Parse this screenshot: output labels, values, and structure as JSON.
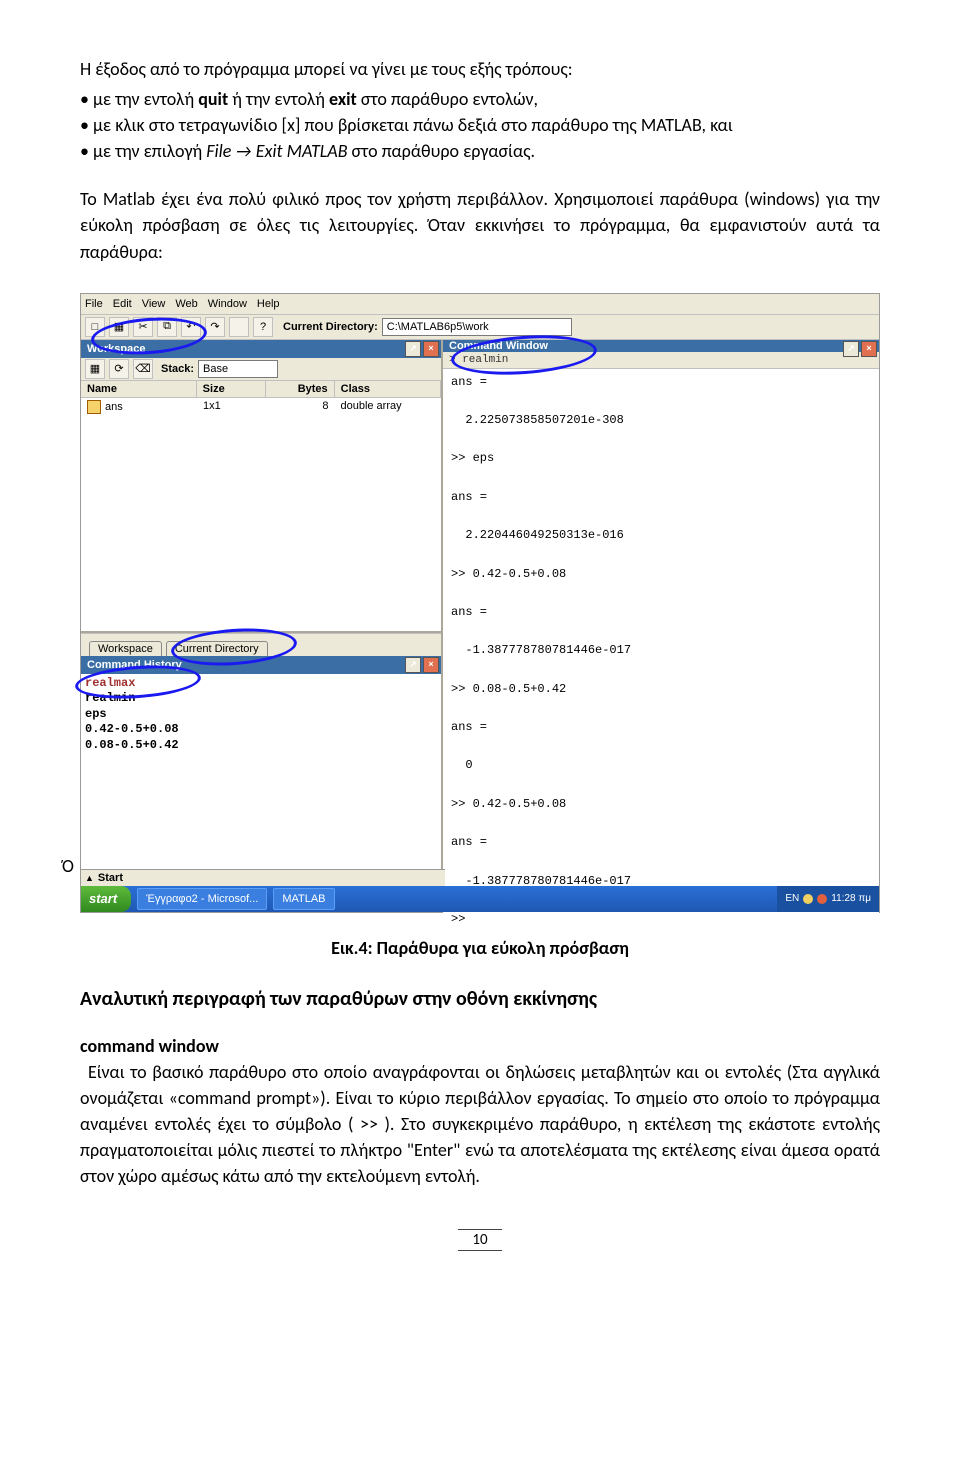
{
  "p1": "Η έξοδος από το πρόγραμμα μπορεί να γίνει με τους εξής τρόπους:",
  "b1_pre": "• με την εντολή ",
  "b1_q": "quit",
  "b1_mid": " ή την εντολή ",
  "b1_e": "exit",
  "b1_post": " στο παράθυρο εντολών,",
  "b2": "• με κλικ στο τετραγωνίδιο [x] που βρίσκεται πάνω δεξιά στο παράθυρο της MATLAB, και",
  "b3_pre": "• με την επιλογή ",
  "b3_i": "File → Exit MATLAB",
  "b3_post": " στο παράθυρο εργασίας.",
  "p2": "Το Matlab έχει ένα πολύ φιλικό προς τον χρήστη περιβάλλον. Χρησιμοποιεί παράθυρα (windows) για την εύκολη πρόσβαση σε όλες τις λειτουργίες. Όταν εκκινήσει το πρόγραμμα, θα εμφανιστούν αυτά τα παράθυρα:",
  "o_marker": "Ό",
  "menubar": [
    "File",
    "Edit",
    "View",
    "Web",
    "Window",
    "Help"
  ],
  "toolbar_icons": [
    "□",
    "▦",
    "✂",
    "⧉",
    "↶",
    "↷",
    "",
    "?"
  ],
  "dir_label": "Current Directory:",
  "dir_value": "C:\\MATLAB6p5\\work",
  "ws_title": "Workspace",
  "stack_label": "Stack:",
  "stack_value": "Base",
  "ws_cols": {
    "name": "Name",
    "size": "Size",
    "bytes": "Bytes",
    "class": "Class"
  },
  "ws_row": {
    "name": "ans",
    "size": "1x1",
    "bytes": "8",
    "class": "double array"
  },
  "tabs": {
    "ws": "Workspace",
    "cd": "Current Directory"
  },
  "ch_title": "Command History",
  "ch_lines": [
    "realmax",
    "realmin",
    "eps",
    "0.42-0.5+0.08",
    "0.08-0.5+0.42"
  ],
  "start_btn_label": "Start",
  "cw_title": "Command Window",
  "cw_first": "> realmin",
  "cw_body": "ans =\n\n  2.225073858507201e-308\n\n>> eps\n\nans =\n\n  2.220446049250313e-016\n\n>> 0.42-0.5+0.08\n\nans =\n\n  -1.387778780781446e-017\n\n>> 0.08-0.5+0.42\n\nans =\n\n  0\n\n>> 0.42-0.5+0.08\n\nans =\n\n  -1.387778780781446e-017\n\n>>",
  "taskbar": {
    "start": "start",
    "t1": "Έγγραφο2 - Microsof...",
    "t2": "MATLAB",
    "lang": "EN",
    "time": "11:28 πμ"
  },
  "start_bar_top_icon": "▲",
  "start_bar_top_label": "Start",
  "caption": "Εικ.4: Παράθυρα για εύκολη πρόσβαση",
  "h2": "Αναλυτική περιγραφή των παραθύρων στην οθόνη εκκίνησης",
  "h3": "command window",
  "p3": "Είναι το βασικό παράθυρο στο οποίο αναγράφονται οι δηλώσεις μεταβλητών και οι εντολές (Στα αγγλικά ονομάζεται «command prompt»). Είναι το κύριο περιβάλλον εργασίας. Το σημείο στο οποίο το πρόγραμμα αναμένει εντολές έχει το σύμβολο ( >> ). Στο συγκεκριμένο παράθυρο, η εκτέλεση της εκάστοτε εντολής πραγματοποιείται μόλις πιεστεί το πλήκτρο \"Enter\" ενώ τα αποτελέσματα της εκτέλεσης είναι άμεσα ορατά στον χώρο αμέσως κάτω από την εκτελούμενη εντολή.",
  "pagenum": "10"
}
